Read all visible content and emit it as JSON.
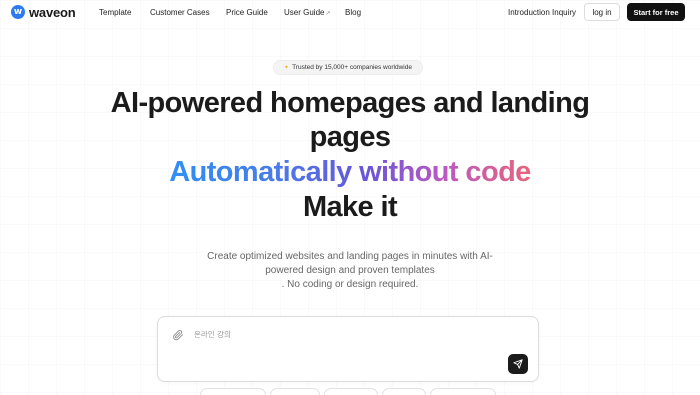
{
  "nav": {
    "logo_mark": "w",
    "logo_text": "waveon",
    "links": [
      "Template",
      "Customer Cases",
      "Price Guide",
      "User Guide",
      "Blog"
    ],
    "inquiry": "Introduction Inquiry",
    "login": "log in",
    "start": "Start for free"
  },
  "badge": {
    "icon": "sparkle-icon",
    "text": "Trusted by 15,000+ companies worldwide"
  },
  "hero": {
    "line1": "AI-powered homepages and landing",
    "line2": "pages",
    "line3": "Automatically without code",
    "line4": "Make it"
  },
  "subtext": {
    "line1": "Create optimized websites and landing pages in minutes with AI-",
    "line2": "powered design and proven templates",
    "line3": ". No coding or design required."
  },
  "prompt": {
    "placeholder": "온라인 강의",
    "clip_icon": "paperclip-icon",
    "send_icon": "send-icon"
  },
  "colors": {
    "accent": "#2d7bf0",
    "button_dark": "#111111",
    "gradient": [
      "#2f8ff5",
      "#6a55d8",
      "#e8647c"
    ]
  }
}
